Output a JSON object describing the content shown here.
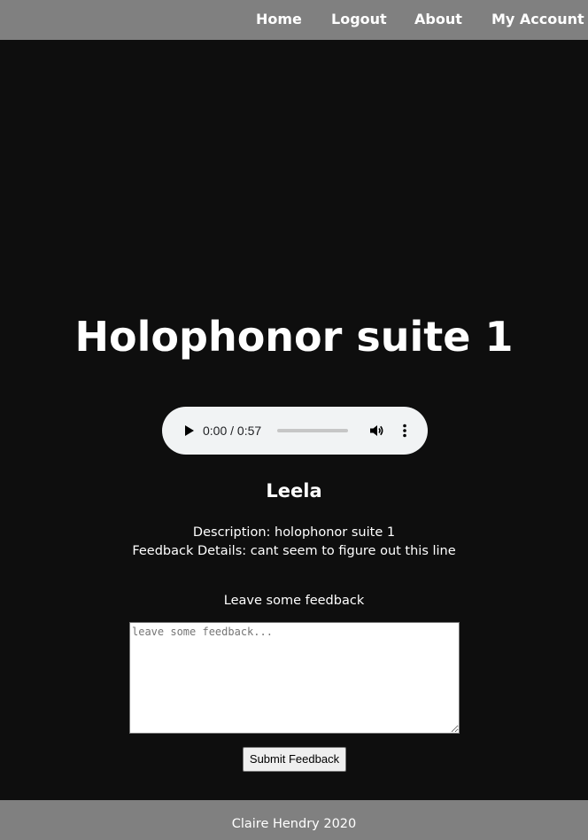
{
  "nav": {
    "items": [
      {
        "label": "Home"
      },
      {
        "label": "Logout"
      },
      {
        "label": "About"
      },
      {
        "label": "My Account"
      }
    ]
  },
  "track": {
    "title": "Holophonor suite 1",
    "artist": "Leela",
    "description_line": "Description: holophonor suite 1",
    "feedback_details_line": "Feedback Details: cant seem to figure out this line"
  },
  "audio": {
    "time_display": "0:00 / 0:57",
    "progress_fraction": 0.0,
    "icons": [
      "play-icon",
      "volume-icon",
      "more-options-icon"
    ]
  },
  "feedback_form": {
    "heading": "Leave some feedback",
    "placeholder": "leave some feedback...",
    "value": "",
    "submit_label": "Submit Feedback"
  },
  "footer": {
    "text": "Claire Hendry 2020"
  },
  "colors": {
    "background": "#0e0e0e",
    "navbar": "#808080",
    "footer": "#808080",
    "player_bg": "#f1f3f4",
    "text": "#ffffff"
  }
}
